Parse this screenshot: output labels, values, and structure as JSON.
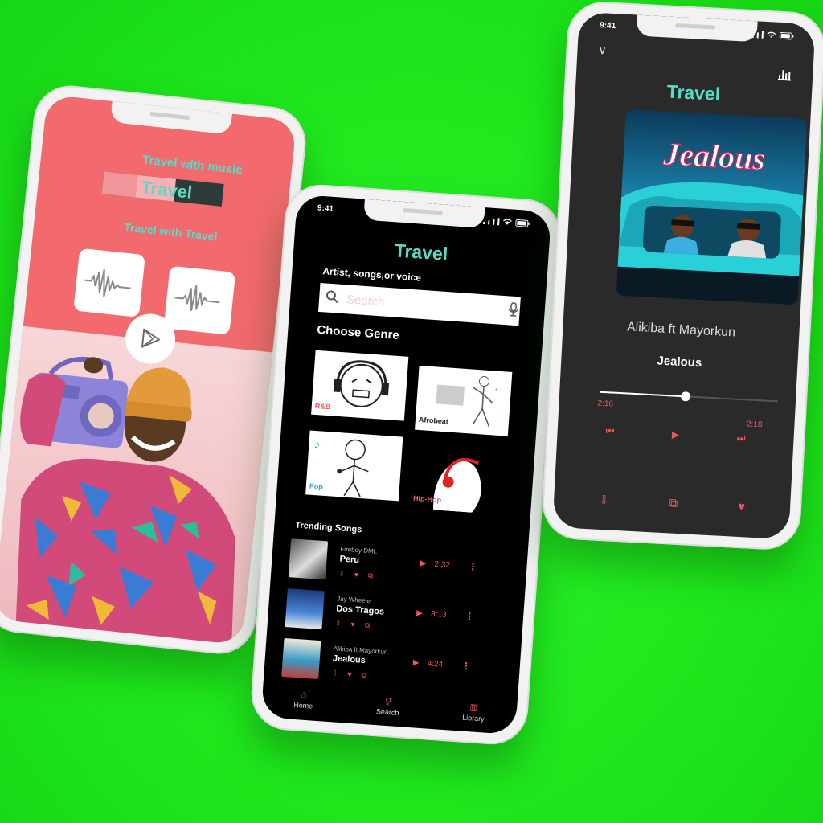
{
  "colors": {
    "accent_teal": "#56dcc6",
    "accent_red": "#f0575a",
    "coral": "#f26a6e",
    "green_bg": "#1fe81c"
  },
  "phone1": {
    "headline_small": "Travel with music",
    "headline_big": "Travel",
    "subline": "Travel with Travel",
    "icons": [
      "waveform-icon",
      "waveform-icon",
      "play-store-icon"
    ]
  },
  "phone2": {
    "status_time": "9:41",
    "title": "Travel",
    "search_label": "Artist, songs,or voice",
    "search_placeholder": "Search",
    "genre_heading": "Choose Genre",
    "genres": [
      {
        "label": "R&B"
      },
      {
        "label": "Afrobeat"
      },
      {
        "label": "Pop"
      },
      {
        "label": "Hip-Hop"
      }
    ],
    "trending_heading": "Trending Songs",
    "tracks": [
      {
        "artist": "Fireboy DML",
        "song": "Peru",
        "duration": "2:32"
      },
      {
        "artist": "Jay Wheeler",
        "song": "Dos Tragos",
        "duration": "3:13"
      },
      {
        "artist": "Alikiba ft Mayorkun",
        "song": "Jealous",
        "duration": "4:24"
      }
    ],
    "nav": [
      {
        "label": "Home",
        "icon": "home-icon"
      },
      {
        "label": "Search",
        "icon": "search-icon"
      },
      {
        "label": "Library",
        "icon": "library-icon"
      }
    ]
  },
  "phone3": {
    "status_time": "9:41",
    "title": "Travel",
    "cover_text": "Jealous",
    "artist": "Alikiba ft Mayorkun",
    "song": "Jealous",
    "elapsed": "2:16",
    "remaining": "-2:18",
    "progress": 0.48
  }
}
